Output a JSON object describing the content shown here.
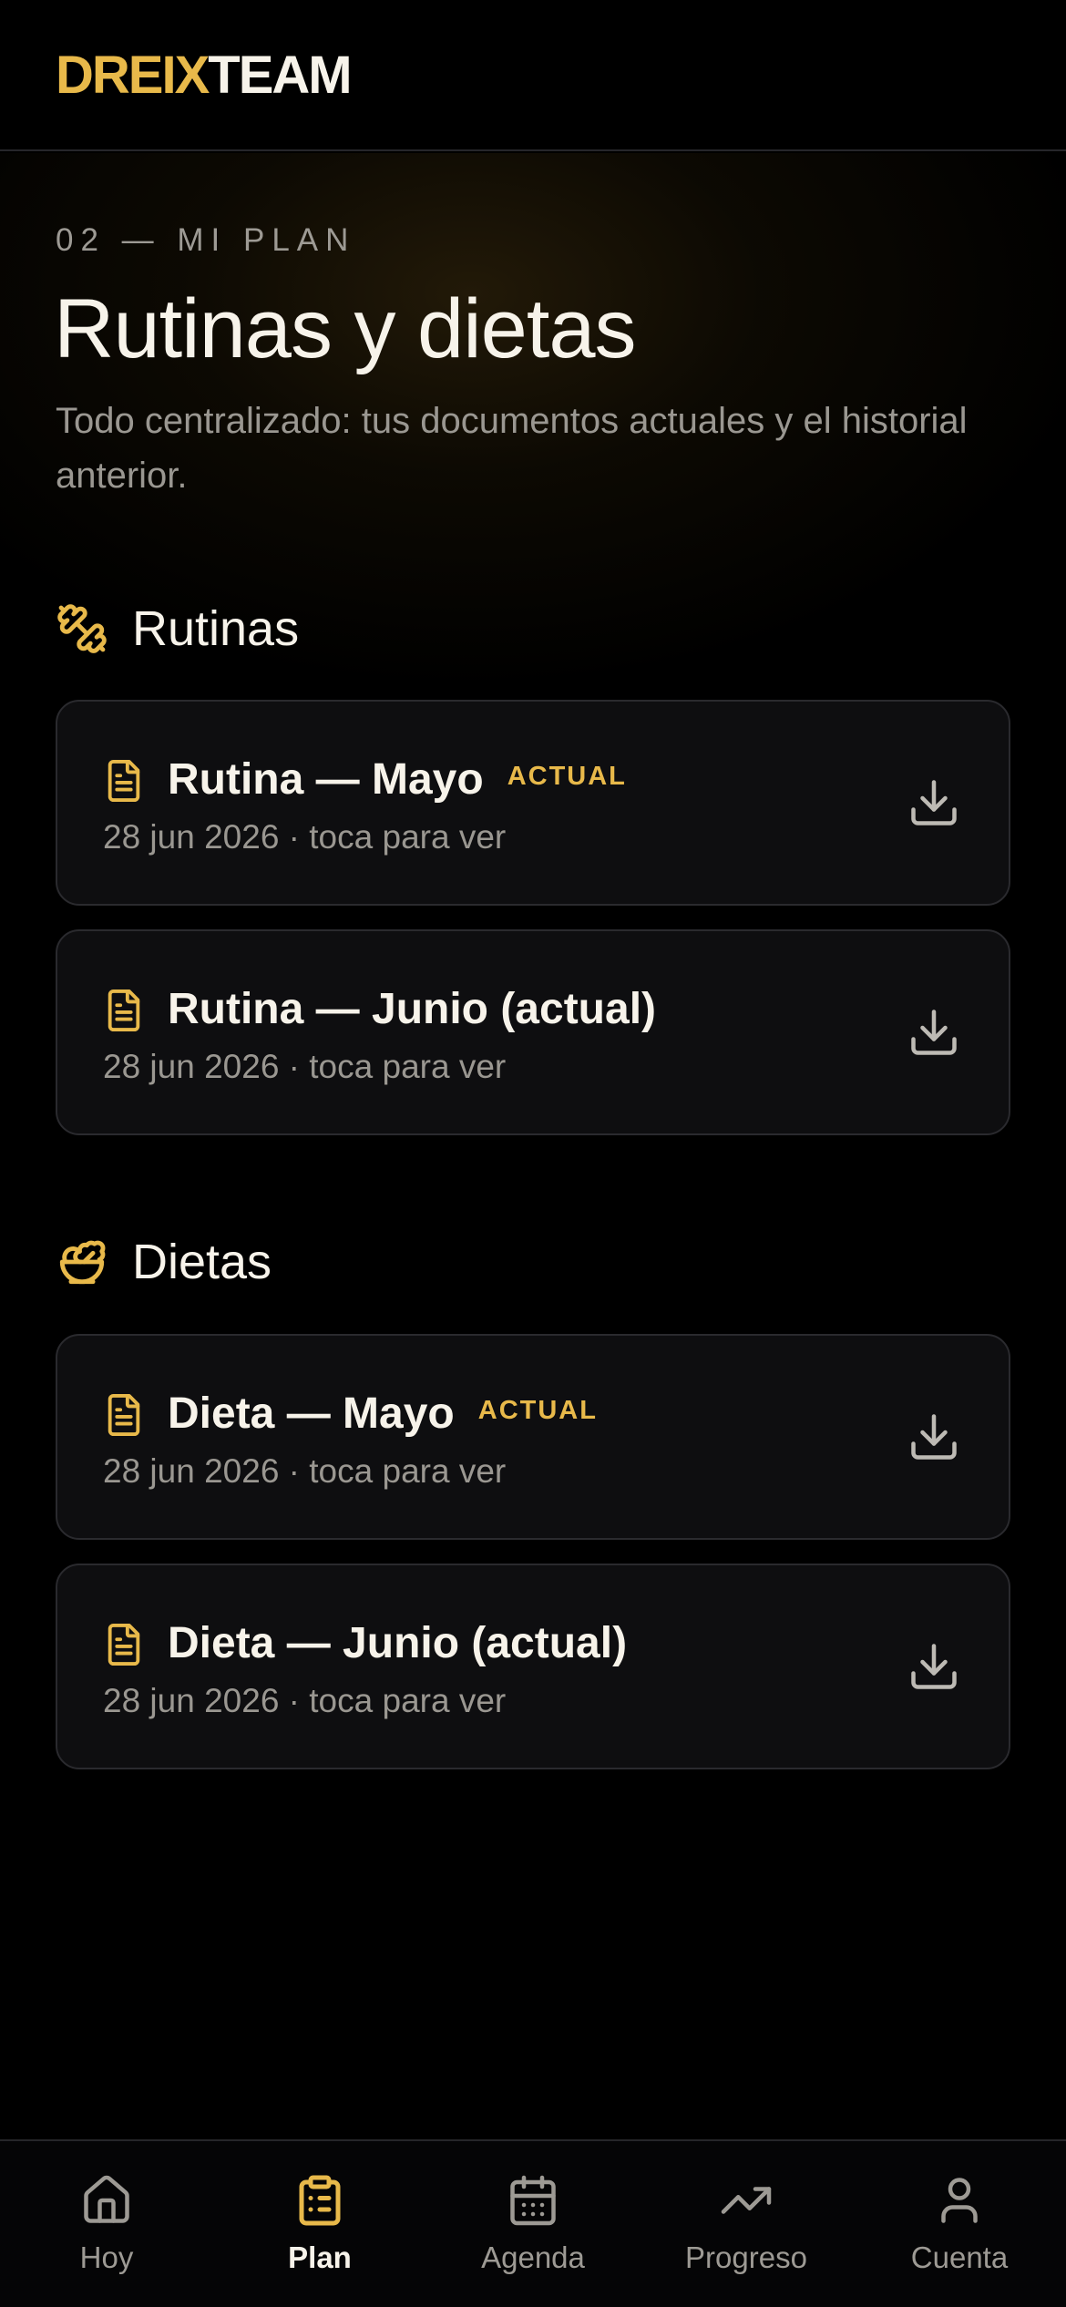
{
  "brand": {
    "part1": "DREIX",
    "part2": "TEAM"
  },
  "header": {
    "kicker": "02 — MI PLAN",
    "title": "Rutinas y dietas",
    "subtitle": "Todo centralizado: tus documentos actuales y el historial anterior."
  },
  "sections": {
    "rutinas": {
      "title": "Rutinas",
      "icon": "dumbbell-icon",
      "items": [
        {
          "title": "Rutina — Mayo",
          "badge": "ACTUAL",
          "meta": "28 jun 2026 · toca para ver"
        },
        {
          "title": "Rutina — Junio (actual)",
          "badge": "",
          "meta": "28 jun 2026 · toca para ver"
        }
      ]
    },
    "dietas": {
      "title": "Dietas",
      "icon": "salad-bowl-icon",
      "items": [
        {
          "title": "Dieta — Mayo",
          "badge": "ACTUAL",
          "meta": "28 jun 2026 · toca para ver"
        },
        {
          "title": "Dieta — Junio (actual)",
          "badge": "",
          "meta": "28 jun 2026 · toca para ver"
        }
      ]
    }
  },
  "nav": {
    "items": [
      {
        "label": "Hoy",
        "icon": "home-icon",
        "active": false
      },
      {
        "label": "Plan",
        "icon": "clipboard-icon",
        "active": true
      },
      {
        "label": "Agenda",
        "icon": "calendar-icon",
        "active": false
      },
      {
        "label": "Progreso",
        "icon": "trending-up-icon",
        "active": false
      },
      {
        "label": "Cuenta",
        "icon": "user-icon",
        "active": false
      }
    ]
  },
  "colors": {
    "accent": "#e8b94a",
    "background": "#000000",
    "card": "#0e0e10",
    "muted": "#9a9791"
  }
}
